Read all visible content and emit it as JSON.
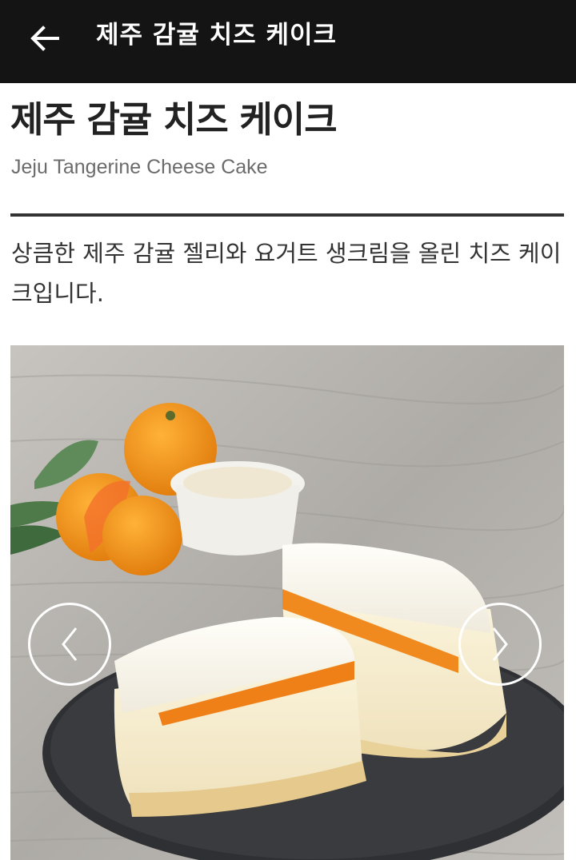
{
  "appbar": {
    "title": "제주 감귤 치즈 케이크",
    "back_icon": "arrow-left-icon"
  },
  "product": {
    "title_ko": "제주 감귤 치즈 케이크",
    "title_en": "Jeju Tangerine Cheese Cake",
    "description": "상큼한 제주 감귤 젤리와 요거트 생크림을 올린 치즈 케이크입니다."
  },
  "gallery": {
    "prev_icon": "chevron-left-icon",
    "next_icon": "chevron-right-icon"
  },
  "colors": {
    "appbar_bg": "#141414",
    "title_text": "#222222",
    "subtitle_text": "#6b6b6b",
    "divider": "#333333"
  }
}
